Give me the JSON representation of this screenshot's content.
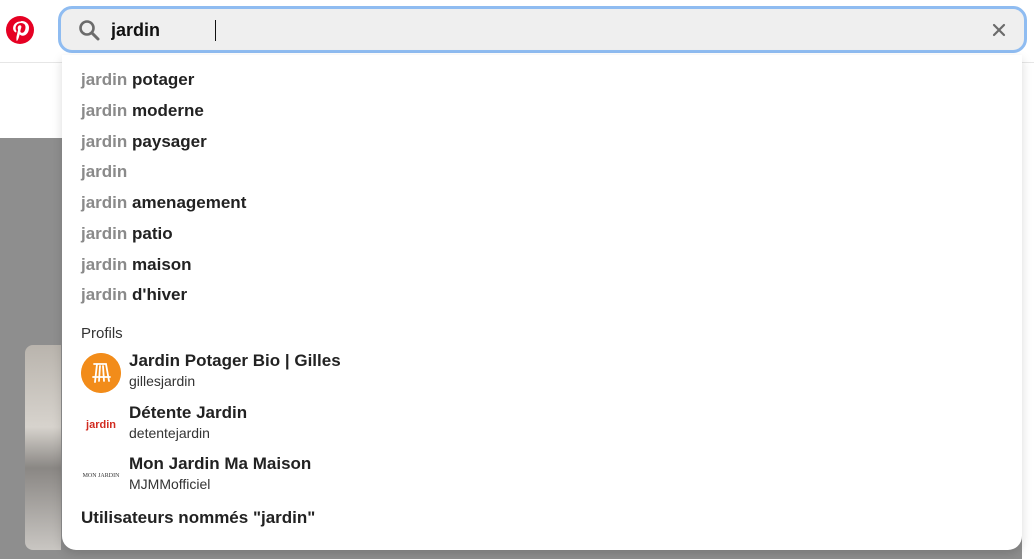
{
  "search": {
    "value": "jardin",
    "clear_icon": "close-icon"
  },
  "suggestions": [
    {
      "query": "jardin",
      "completion": "potager"
    },
    {
      "query": "jardin",
      "completion": "moderne"
    },
    {
      "query": "jardin",
      "completion": "paysager"
    },
    {
      "query": "jardin",
      "completion": ""
    },
    {
      "query": "jardin",
      "completion": "amenagement"
    },
    {
      "query": "jardin",
      "completion": "patio"
    },
    {
      "query": "jardin",
      "completion": "maison"
    },
    {
      "query": "jardin",
      "completion": "d'hiver"
    }
  ],
  "profiles_section": {
    "title": "Profils",
    "items": [
      {
        "name": "Jardin Potager Bio | Gilles",
        "handle": "gillesjardin"
      },
      {
        "name": "Détente Jardin",
        "handle": "detentejardin",
        "avatar_text": "jardin"
      },
      {
        "name": "Mon Jardin Ma Maison",
        "handle": "MJMMofficiel",
        "avatar_text": "MON JARDIN"
      }
    ]
  },
  "users_named": "Utilisateurs nommés \"jardin\"",
  "colors": {
    "brand": "#e60023",
    "focus_ring": "#8fbcf1",
    "avatar_orange": "#f28c1a"
  }
}
